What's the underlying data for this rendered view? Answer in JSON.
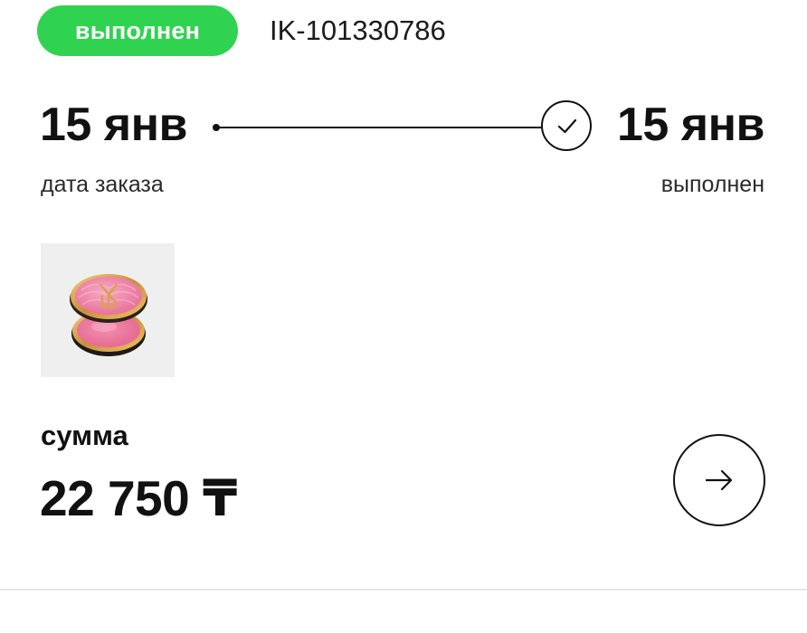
{
  "order": {
    "status": "выполнен",
    "id": "IK-101330786"
  },
  "timeline": {
    "start": {
      "date": "15 янв",
      "caption": "дата заказа"
    },
    "end": {
      "date": "15 янв",
      "caption": "выполнен",
      "icon": "check-icon"
    }
  },
  "product": {
    "image_icon": "blush-compact-image",
    "colors": {
      "thumb_bg": "#efefef",
      "blush_pink": "#f07ca2",
      "gold": "#d9a24a"
    }
  },
  "summary": {
    "label": "сумма",
    "value": "22 750 ₸"
  },
  "details_button": {
    "icon": "arrow-right-icon"
  },
  "colors": {
    "status_green": "#2fd34f",
    "text": "#111111"
  }
}
